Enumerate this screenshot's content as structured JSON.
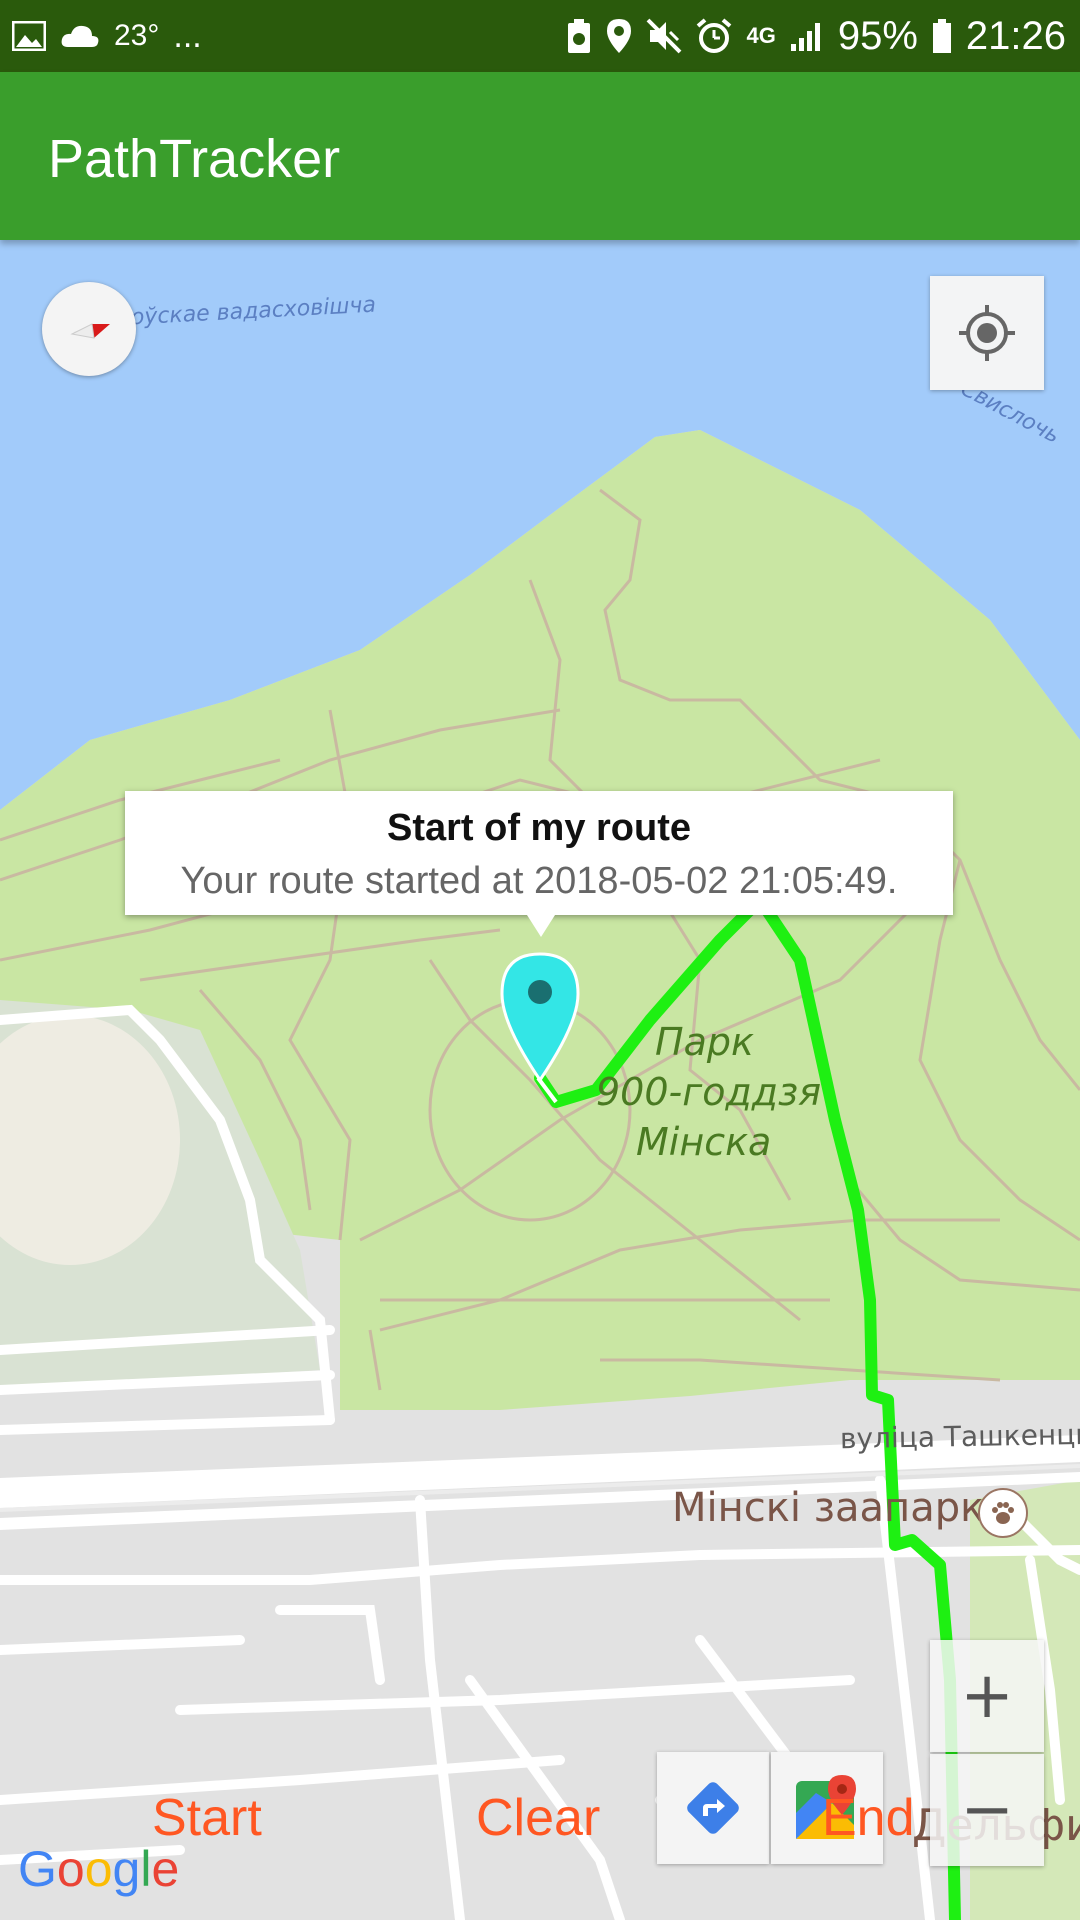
{
  "status_bar": {
    "temperature": "23°",
    "more": "...",
    "network": "4G",
    "battery": "95%",
    "time": "21:26"
  },
  "app": {
    "title": "PathTracker"
  },
  "map": {
    "labels": {
      "reservoir": "...жоўскае вадасховішча",
      "river": "Свислочь",
      "park_line1": "Парк",
      "park_line2": "900-годдзя",
      "park_line3": "Мінска",
      "street": "вуліца Ташкенцк",
      "zoo": "Мінскі заапарк",
      "dolphin": "Дельфин"
    },
    "info_window": {
      "title": "Start of my route",
      "snippet": "Your route started at 2018-05-02 21:05:49."
    },
    "zoom_in": "+",
    "zoom_out": "−"
  },
  "actions": {
    "start": "Start",
    "clear": "Clear",
    "end": "End"
  },
  "google_logo": [
    "G",
    "o",
    "o",
    "g",
    "l",
    "e"
  ],
  "colors": {
    "status_bar": "#2a5a0c",
    "app_bar": "#3a9e2c",
    "water": "#a2cbfa",
    "park": "#c9e6a3",
    "route": "#1ef012",
    "marker": "#33e6e6",
    "action_text": "#ff5722"
  }
}
